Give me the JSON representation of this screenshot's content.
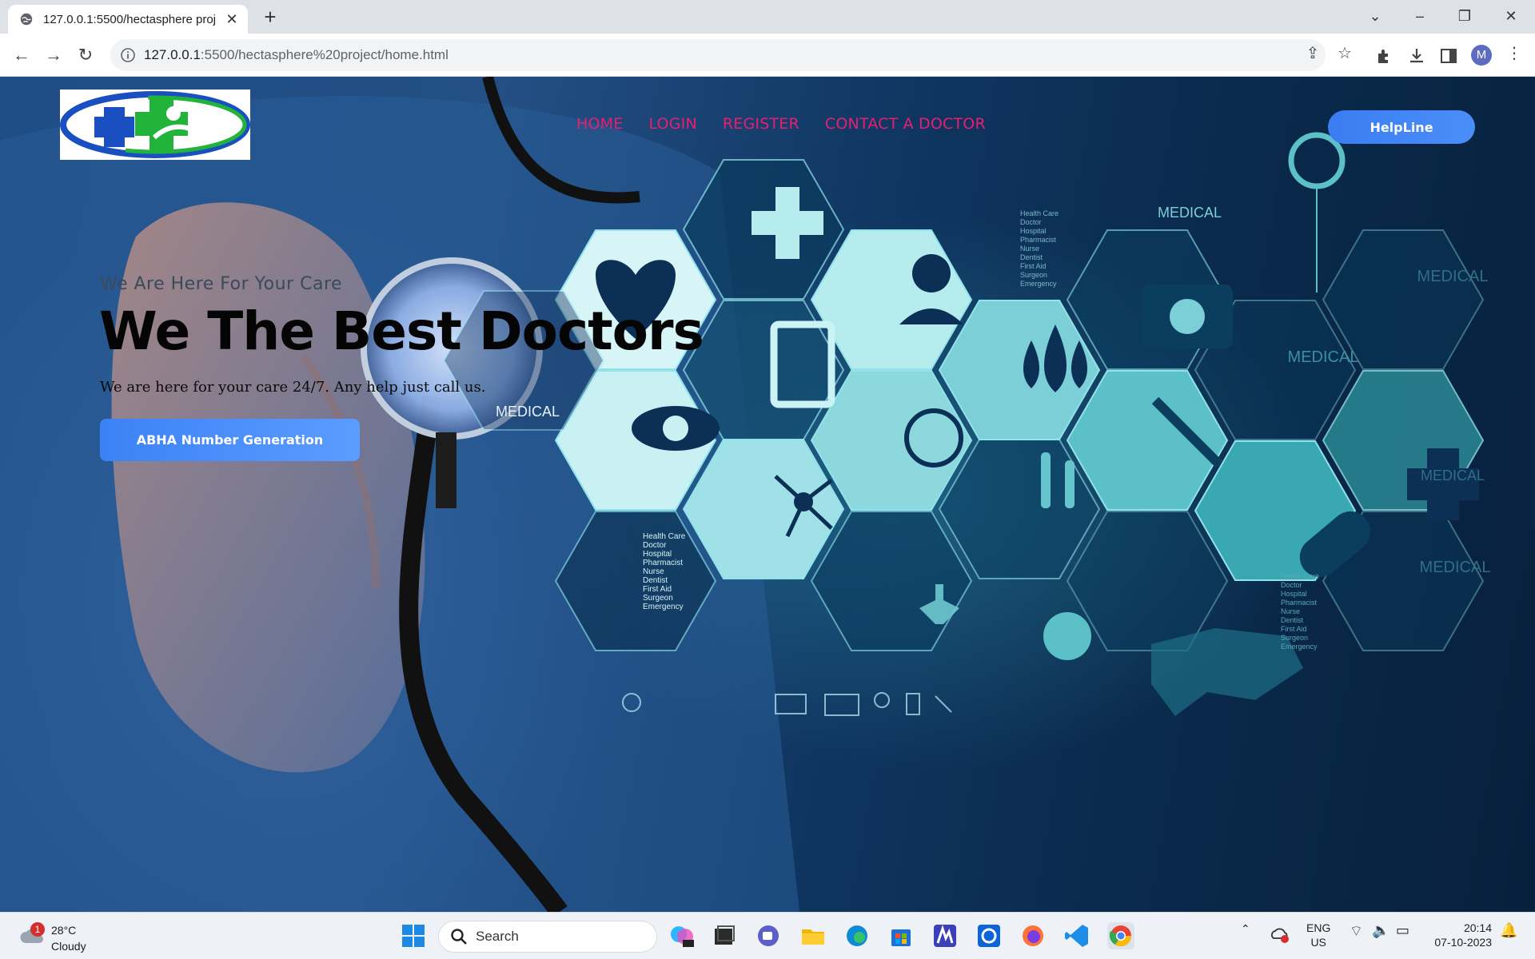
{
  "browser": {
    "tab_title": "127.0.0.1:5500/hectasphere proj",
    "url_host": "127.0.0.1",
    "url_rest": ":5500/hectasphere%20project/home.html",
    "new_tab": "+",
    "tab_close": "✕"
  },
  "page": {
    "nav": [
      "HOME",
      "LOGIN",
      "REGISTER",
      "CONTACT A DOCTOR"
    ],
    "helpline_label": "HelpLine",
    "hero_subtitle": "We Are Here For Your Care",
    "hero_title": "We The Best Doctors",
    "hero_description": "We are here for your care 24/7. Any help just call us.",
    "cta_label": "ABHA Number Generation",
    "background_labels": {
      "medical": "MEDICAL",
      "services_list": [
        "Health Care",
        "Doctor",
        "Hospital",
        "Pharmacist",
        "Nurse",
        "Dentist",
        "First Aid",
        "Surgeon",
        "Emergency"
      ]
    },
    "colors": {
      "nav": "#e91e72",
      "button": "#3b82f6"
    }
  },
  "taskbar": {
    "weather_badge": "1",
    "weather_temp": "28°C",
    "weather_condition": "Cloudy",
    "search_label": "Search",
    "lang_line1": "ENG",
    "lang_line2": "US",
    "time": "20:14",
    "date": "07-10-2023"
  },
  "profile_initial": "M"
}
